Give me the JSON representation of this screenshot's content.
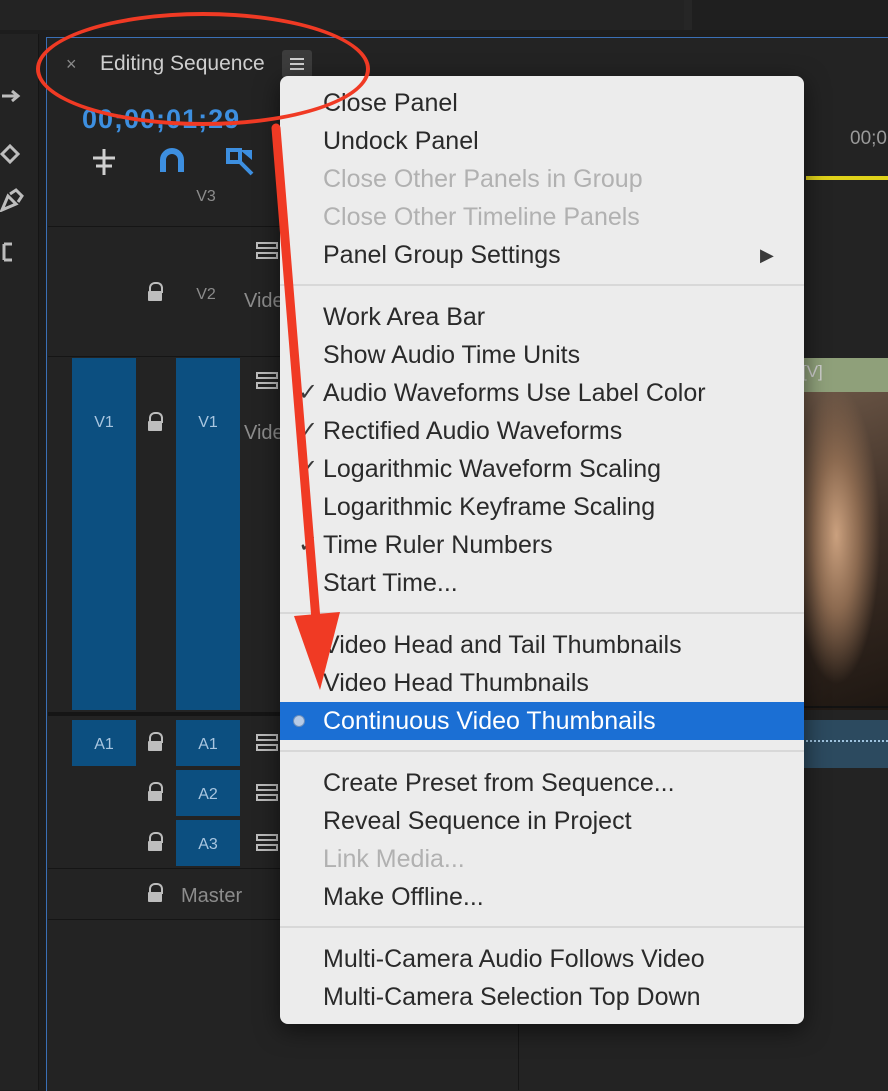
{
  "panel": {
    "close_glyph": "×",
    "title": "Editing Sequence",
    "timecode": "00;00;01;29",
    "ruler_time": "00;0"
  },
  "tracks": {
    "v3": "V3",
    "v2": "V2",
    "v1_source": "V1",
    "v1": "V1",
    "a1_source": "A1",
    "a1": "A1",
    "a2": "A2",
    "a3": "A3",
    "master": "Master",
    "v2_name": "Vide",
    "v1_name": "Vide"
  },
  "clip": {
    "label": "[V]"
  },
  "menu": {
    "group1": [
      {
        "label": "Close Panel",
        "enabled": true
      },
      {
        "label": "Undock Panel",
        "enabled": true
      },
      {
        "label": "Close Other Panels in Group",
        "enabled": false
      },
      {
        "label": "Close Other Timeline Panels",
        "enabled": false
      },
      {
        "label": "Panel Group Settings",
        "enabled": true,
        "submenu": "▶"
      }
    ],
    "group2": [
      {
        "label": "Work Area Bar",
        "checked": false
      },
      {
        "label": "Show Audio Time Units",
        "checked": false
      },
      {
        "label": "Audio Waveforms Use Label Color",
        "checked": true
      },
      {
        "label": "Rectified Audio Waveforms",
        "checked": true
      },
      {
        "label": "Logarithmic Waveform Scaling",
        "checked": true
      },
      {
        "label": "Logarithmic Keyframe Scaling",
        "checked": false
      },
      {
        "label": "Time Ruler Numbers",
        "checked": true
      },
      {
        "label": "Start Time...",
        "checked": false
      }
    ],
    "group3": [
      {
        "label": "Video Head and Tail Thumbnails",
        "selected": false
      },
      {
        "label": "Video Head Thumbnails",
        "selected": false
      },
      {
        "label": "Continuous Video Thumbnails",
        "selected": true
      }
    ],
    "group4": [
      {
        "label": "Create Preset from Sequence...",
        "enabled": true
      },
      {
        "label": "Reveal Sequence in Project",
        "enabled": true
      },
      {
        "label": "Link Media...",
        "enabled": false
      },
      {
        "label": "Make Offline...",
        "enabled": true
      }
    ],
    "group5": [
      {
        "label": "Multi-Camera Audio Follows Video",
        "enabled": true
      },
      {
        "label": "Multi-Camera Selection Top Down",
        "enabled": true
      }
    ],
    "check_glyph": "✓"
  },
  "colors": {
    "highlight": "#1b6fd4",
    "annotation": "#f03a24",
    "timecode": "#3d8fe0",
    "track_blue": "#0c4f80"
  }
}
